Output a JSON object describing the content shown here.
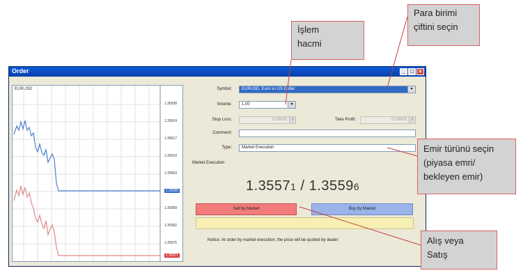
{
  "window": {
    "title": "Order",
    "buttons": {
      "minimize": "_",
      "maximize": "□",
      "close": "×"
    }
  },
  "chart": {
    "symbol_label": "EURUSD",
    "price_ticks": [
      "1.35638",
      "1.35624",
      "1.35617",
      "1.35610",
      "1.35603",
      "1.35596",
      "1.35589",
      "1.35582",
      "1.35575",
      "1.35568"
    ],
    "highlight_tick": "1.35596",
    "highlight_tick_bottom": "1.35571",
    "colors": {
      "ask_line": "#4a7fcf",
      "bid_line": "#e28a8a"
    }
  },
  "form": {
    "symbol_label": "Symbol:",
    "symbol_value": "EURUSD, Euro vs US Dollar",
    "volume_label": "Volume:",
    "volume_value": "1.00",
    "stoploss_label": "Stop Loss:",
    "stoploss_value": "0.00000",
    "takeprofit_label": "Take Profit:",
    "takeprofit_value": "0.00000",
    "comment_label": "Comment:",
    "comment_value": "",
    "type_label": "Type:",
    "type_value": "Market Execution"
  },
  "section_label": "Market Execution",
  "quote": {
    "bid_main": "1.3557",
    "bid_small": "1",
    "separator": " / ",
    "ask_main": "1.3559",
    "ask_small": "6"
  },
  "buttons": {
    "sell": "Sell by Market",
    "buy": "Buy by Market"
  },
  "notice": "Notice: At order by market execution, the price will be quoted by dealer",
  "callouts": {
    "volume": [
      "İşlem",
      "hacmi"
    ],
    "currency": [
      "Para birimi",
      "çiftini seçin"
    ],
    "type": [
      "Emir türünü seçin",
      "(piyasa emri/",
      "bekleyen emir)"
    ],
    "side": [
      "Alış veya",
      "Satış"
    ]
  }
}
